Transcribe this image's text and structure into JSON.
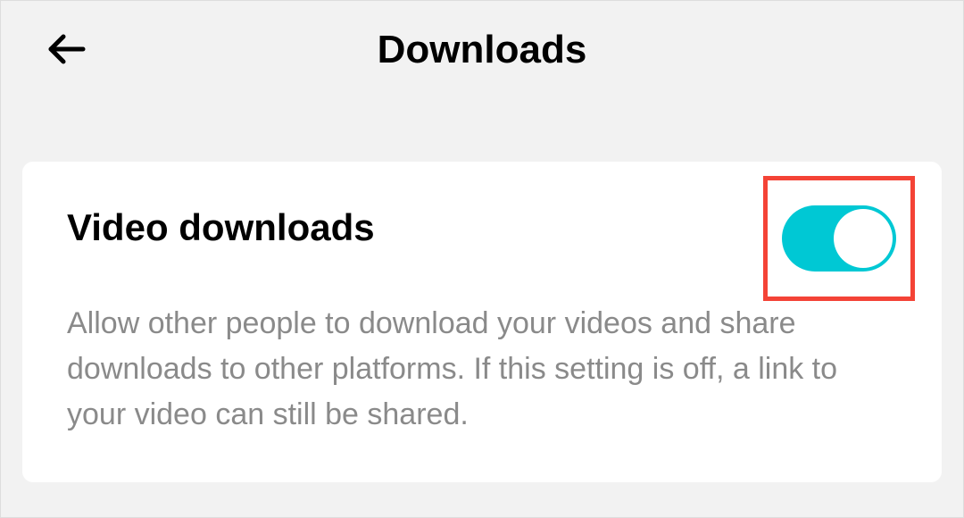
{
  "header": {
    "title": "Downloads"
  },
  "setting": {
    "title": "Video downloads",
    "description": "Allow other people to download your videos and share downloads to other platforms. If this setting is off, a link to your video can still be shared.",
    "toggle_on": true
  }
}
